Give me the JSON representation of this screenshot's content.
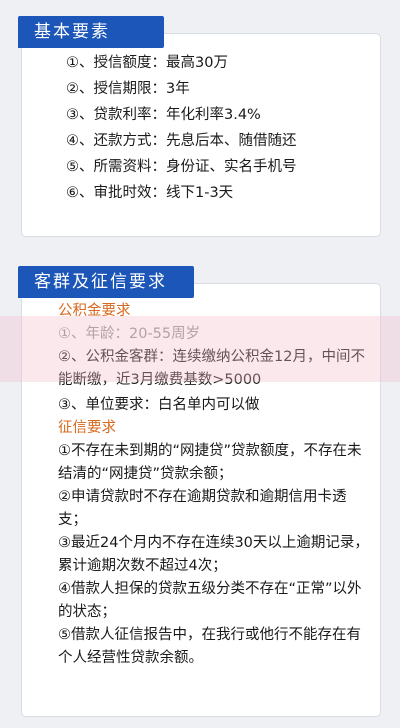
{
  "section1": {
    "title": "基本要素",
    "items": [
      {
        "label": "①、授信额度：",
        "value": "最高30万"
      },
      {
        "label": "②、授信期限：",
        "value": "3年"
      },
      {
        "label": "③、贷款利率：",
        "value": "年化利率3.4%"
      },
      {
        "label": "④、还款方式：",
        "value": "先息后本、随借随还"
      },
      {
        "label": "⑤、所需资料：",
        "value": "身份证、实名手机号"
      },
      {
        "label": "⑥、审批时效：",
        "value": "线下1-3天"
      }
    ]
  },
  "section2": {
    "title": "客群及征信要求",
    "fund": {
      "heading": "公积金要求",
      "line1": "①、年龄：20-55周岁",
      "line2": "②、公积金客群：连续缴纳公积金12月，中间不能断缴，近3月缴费基数>5000",
      "line3": "③、单位要求：白名单内可以做"
    },
    "credit": {
      "heading": "征信要求",
      "items": [
        "①不存在未到期的“网捷贷”贷款额度，不存在未结清的“网捷贷”贷款余额；",
        "②申请贷款时不存在逾期贷款和逾期信用卡透支；",
        "③最近24个月内不存在连续30天以上逾期记录，累计逾期次数不超过4次；",
        "④借款人担保的贷款五级分类不存在“正常”以外的状态；",
        "⑤借款人征信报告中，在我行或他行不能存在有个人经营性贷款余额。"
      ]
    }
  },
  "colors": {
    "tab_blue": "#1c56b8",
    "sub_heading_orange": "#d9691f",
    "page_bg": "#eef0f4"
  }
}
